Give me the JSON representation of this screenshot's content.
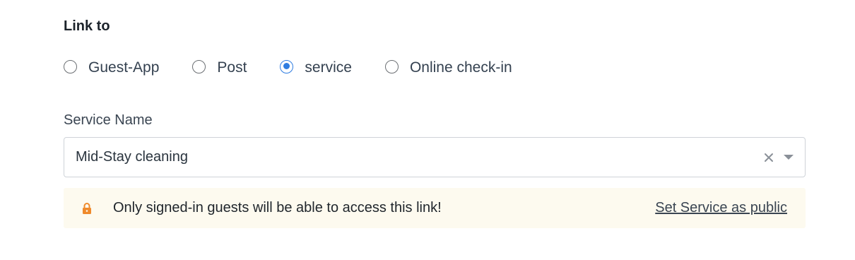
{
  "link_to": {
    "title": "Link to",
    "options": [
      {
        "label": "Guest-App",
        "checked": false
      },
      {
        "label": "Post",
        "checked": false
      },
      {
        "label": "service",
        "checked": true
      },
      {
        "label": "Online check-in",
        "checked": false
      }
    ]
  },
  "service_name": {
    "label": "Service Name",
    "value": "Mid-Stay cleaning",
    "icons": [
      "clear-icon",
      "chevron-down-icon"
    ]
  },
  "notice": {
    "icon": "lock-icon",
    "text": "Only signed-in guests will be able to access this link!",
    "link_label": "Set Service as public"
  },
  "colors": {
    "accent": "#2f7de1",
    "lock": "#ef8a2c",
    "notice_bg": "#fdfaef"
  }
}
